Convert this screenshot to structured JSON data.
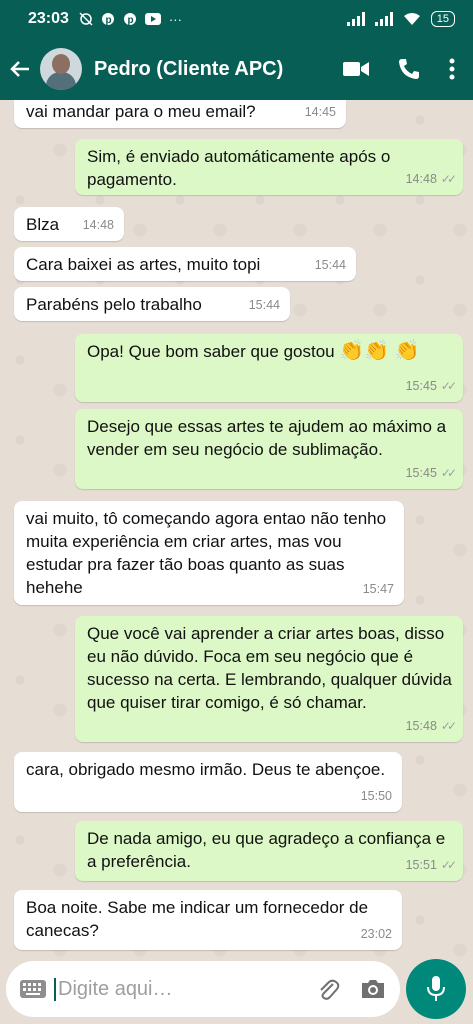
{
  "status": {
    "time": "23:03",
    "battery": "15"
  },
  "header": {
    "contact_name": "Pedro (Cliente APC)"
  },
  "messages": [
    {
      "text": "vai mandar para o meu email?",
      "time": "14:45"
    },
    {
      "text": "Sim, é enviado automáticamente após o pagamento.",
      "time": "14:48"
    },
    {
      "text": "Blza",
      "time": "14:48"
    },
    {
      "text": "Cara baixei as artes, muito topi",
      "time": "15:44"
    },
    {
      "text": "Parabéns pelo trabalho",
      "time": "15:44"
    },
    {
      "text": "Opa! Que bom saber que gostou",
      "emoji": "👏👏 👏",
      "time": "15:45"
    },
    {
      "text": "Desejo que essas artes te ajudem ao máximo a vender em seu negócio de sublimação.",
      "time": "15:45"
    },
    {
      "text": "vai muito, tô começando agora entao não tenho muita experiência em criar artes, mas vou estudar pra fazer tão boas quanto as suas hehehe",
      "time": "15:47"
    },
    {
      "text": "Que você vai aprender a criar artes boas, disso eu não dúvido. Foca em seu negócio que é sucesso na certa. E lembrando, qualquer dúvida que quiser tirar comigo, é só chamar.",
      "time": "15:48"
    },
    {
      "text": "cara, obrigado mesmo irmão. Deus te abençoe.",
      "time": "15:50"
    },
    {
      "text": "De nada amigo, eu que agradeço a confiança e a preferência.",
      "time": "15:51"
    },
    {
      "text": "Boa noite. Sabe me indicar um fornecedor de canecas?",
      "time": "23:02"
    }
  ],
  "input": {
    "placeholder": "Digite aqui…"
  },
  "colors": {
    "header": "#075e54",
    "outgoing_bubble": "#dcf8c6",
    "incoming_bubble": "#ffffff",
    "mic_button": "#00897b"
  }
}
